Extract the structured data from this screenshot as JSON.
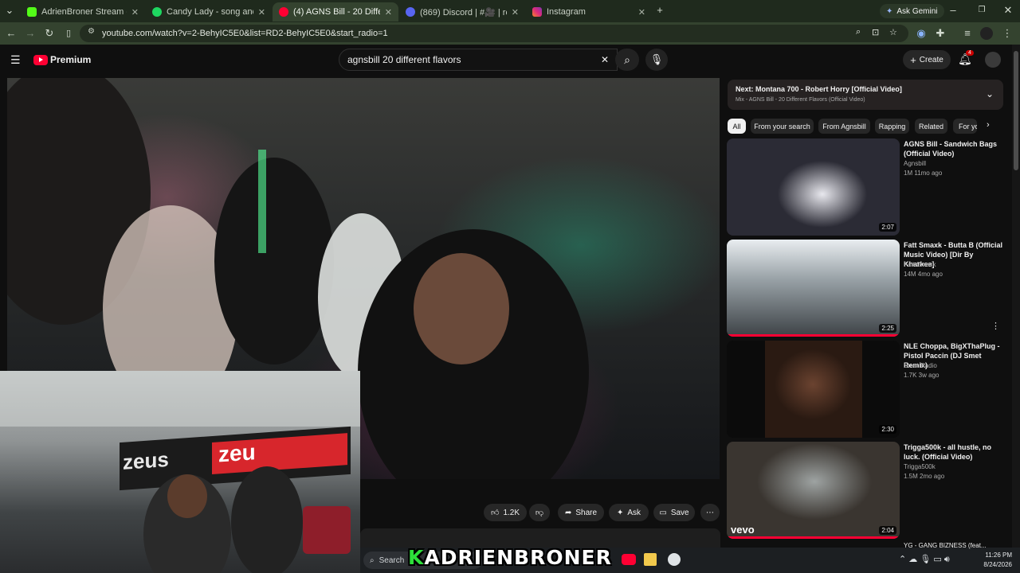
{
  "browser": {
    "tabs": [
      {
        "title": "AdrienBroner Stream - Watch Live",
        "icon_color": "#53fc18"
      },
      {
        "title": "Candy Lady - song and lyrics by",
        "icon_color": "#1ed760"
      },
      {
        "title": "(4) AGNS Bill - 20 Different",
        "icon_color": "#ff0033"
      },
      {
        "title": "(869) Discord | #🎥 | reactions",
        "icon_color": "#5865f2"
      },
      {
        "title": "Instagram",
        "icon_color": "#e1306c"
      }
    ],
    "ask_gemini": "Ask Gemini",
    "url": "youtube.com/watch?v=2-BehyIC5E0&list=RD2-BehyIC5E0&start_radio=1"
  },
  "youtube": {
    "logo_text": "Premium",
    "search_value": "agnsbill 20 different flavors",
    "create_label": "Create",
    "notif_count": "4"
  },
  "actions": {
    "likes": "1.2K",
    "share": "Share",
    "ask": "Ask",
    "save": "Save"
  },
  "next_up": {
    "title": "Next: Montana 700 - Robert Horry [Official Video]",
    "subtitle": "Mix - AGNS Bill - 20 Different Flavors (Official Video)"
  },
  "chips": [
    "All",
    "From your search",
    "From Agnsbill",
    "Rapping",
    "Related",
    "For yo"
  ],
  "recommendations": [
    {
      "title": "AGNS Bill - Sandwich Bags (Official Video)",
      "channel": "Agnsbill",
      "meta": "1M  11mo ago",
      "duration": "2:07"
    },
    {
      "title": "Fatt Smaxk - Butta B (Official Music Video) [Dir By Kharkee]",
      "channel": "Fatt Smaxk",
      "meta": "14M  4mo ago",
      "duration": "2:25"
    },
    {
      "title": "NLE Choppa, BigXThaPlug - Pistol Paccin (DJ Smet Remix)",
      "channel": "Smet Radio",
      "meta": "1.7K  3w ago",
      "duration": "2:30"
    },
    {
      "title": "Trigga500k - all hustle, no luck. (Official Video)",
      "channel": "Trigga500k",
      "meta": "1.5M  2mo ago",
      "duration": "2:04"
    }
  ],
  "video_overlays": {
    "vevo": "vevo",
    "zeus": "zeus",
    "zeus2": "zeu"
  },
  "taskbar": {
    "search": "Search",
    "overlay_k": "K",
    "overlay_name": "ADRIENBRONER",
    "time": "11:26 PM",
    "date": "8/24/2026",
    "partial_next": "YG - GANG BIZNESS (feat..."
  }
}
